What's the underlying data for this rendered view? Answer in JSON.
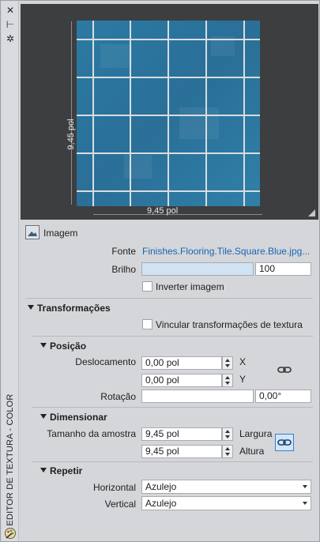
{
  "palette": {
    "panel_bg": "#d4d6d9",
    "preview_bg": "#3d3e40",
    "tile_blue": "#2f7ba3",
    "grout": "#d8dde0",
    "link_blue": "#1b64b8"
  },
  "strip": {
    "close_glyph": "✕",
    "pin_glyph": "⊢",
    "settings_glyph": "✲",
    "title": "EDITOR DE TEXTURA - COLOR"
  },
  "preview": {
    "height_label": "9,45 pol",
    "width_label": "9,45 pol"
  },
  "image": {
    "label": "Imagem",
    "source_label": "Fonte",
    "source_value": "Finishes.Flooring.Tile.Square.Blue.jpg...",
    "brightness_label": "Brilho",
    "brightness_value": "100",
    "brightness_level": 0,
    "invert_label": "Inverter imagem",
    "invert_checked": false
  },
  "transforms": {
    "title": "Transformações",
    "link_label": "Vincular transformações de textura",
    "link_checked": false,
    "position": {
      "title": "Posição",
      "offset_label": "Deslocamento",
      "offset_x": "0,00 pol",
      "offset_y": "0,00 pol",
      "x_label": "X",
      "y_label": "Y",
      "rotation_label": "Rotação",
      "rotation_value": "0,00°"
    },
    "scale": {
      "title": "Dimensionar",
      "sample_size_label": "Tamanho da amostra",
      "width_value": "9,45 pol",
      "height_value": "9,45 pol",
      "width_label": "Largura",
      "height_label": "Altura"
    },
    "repeat": {
      "title": "Repetir",
      "horizontal_label": "Horizontal",
      "horizontal_value": "Azulejo",
      "vertical_label": "Vertical",
      "vertical_value": "Azulejo"
    }
  }
}
